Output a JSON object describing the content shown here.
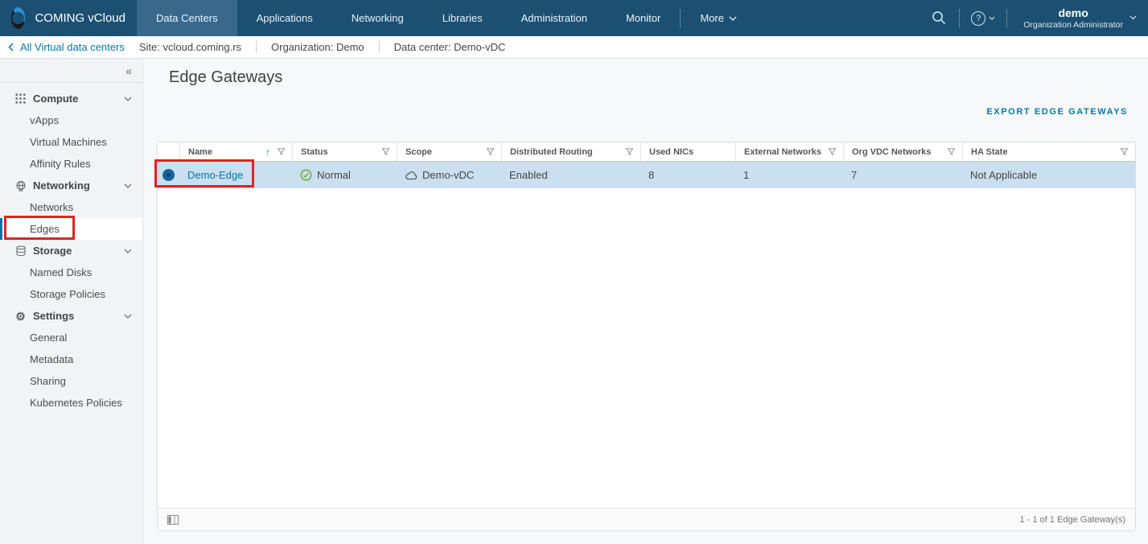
{
  "app": {
    "brand": "COMING vCloud"
  },
  "icons": {
    "collapse": "«",
    "sort_asc": "↑",
    "help": "?",
    "gear": "⚙"
  },
  "colors": {
    "topbar": "#1b5072",
    "topbar_active_tab": "#38698c",
    "accent_blue": "#0079ad",
    "row_selected": "#cadff0",
    "status_ok_green": "#61a527",
    "sidebar_active_bar": "#0076a8",
    "annotation_red": "#e12323"
  },
  "topnav": {
    "items": [
      {
        "label": "Data Centers"
      },
      {
        "label": "Applications"
      },
      {
        "label": "Networking"
      },
      {
        "label": "Libraries"
      },
      {
        "label": "Administration"
      },
      {
        "label": "Monitor"
      }
    ],
    "active": "Data Centers",
    "more_label": "More",
    "user_name": "demo",
    "user_role": "Organization Administrator"
  },
  "breadcrumb": {
    "back_label": "All Virtual data centers",
    "site": "Site: vcloud.coming.rs",
    "organization": "Organization: Demo",
    "data_center": "Data center: Demo-vDC"
  },
  "sidebar": {
    "active_item": "Edges",
    "sections": [
      {
        "label": "Compute",
        "items": [
          {
            "label": "vApps"
          },
          {
            "label": "Virtual Machines"
          },
          {
            "label": "Affinity Rules"
          }
        ]
      },
      {
        "label": "Networking",
        "items": [
          {
            "label": "Networks"
          },
          {
            "label": "Edges"
          }
        ]
      },
      {
        "label": "Storage",
        "items": [
          {
            "label": "Named Disks"
          },
          {
            "label": "Storage Policies"
          }
        ]
      },
      {
        "label": "Settings",
        "items": [
          {
            "label": "General"
          },
          {
            "label": "Metadata"
          },
          {
            "label": "Sharing"
          },
          {
            "label": "Kubernetes Policies"
          }
        ]
      }
    ]
  },
  "main": {
    "title": "Edge Gateways",
    "export_label": "EXPORT EDGE GATEWAYS",
    "table": {
      "columns": [
        {
          "label": "Name",
          "sorted": "asc",
          "filterable": true
        },
        {
          "label": "Status",
          "filterable": true
        },
        {
          "label": "Scope",
          "filterable": true
        },
        {
          "label": "Distributed Routing",
          "filterable": true
        },
        {
          "label": "Used NICs",
          "filterable": false
        },
        {
          "label": "External Networks",
          "filterable": true
        },
        {
          "label": "Org VDC Networks",
          "filterable": true
        },
        {
          "label": "HA State",
          "filterable": true
        }
      ],
      "rows": [
        {
          "selected": true,
          "name": "Demo-Edge",
          "status": "Normal",
          "scope": "Demo-vDC",
          "distributed_routing": "Enabled",
          "used_nics": "8",
          "external_networks": "1",
          "org_vdc_networks": "7",
          "ha_state": "Not Applicable"
        }
      ],
      "footer_count": "1 - 1 of 1 Edge Gateway(s)"
    }
  }
}
